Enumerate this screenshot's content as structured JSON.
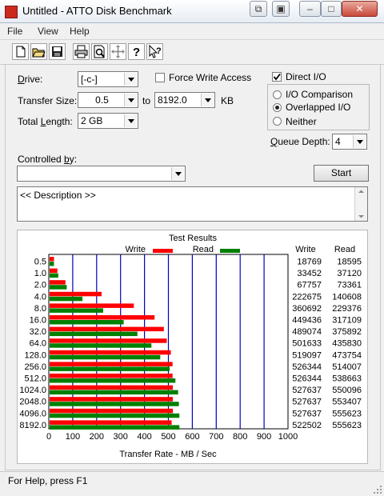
{
  "window": {
    "title": "Untitled - ATTO Disk Benchmark"
  },
  "menu": [
    "File",
    "View",
    "Help"
  ],
  "toolbar_icons": [
    "new-file-icon",
    "open-folder-icon",
    "save-icon",
    "print-icon",
    "print-preview-icon",
    "move-icon",
    "help-icon",
    "context-help-icon"
  ],
  "form": {
    "drive_label": "Drive:",
    "drive_value": "[-c-]",
    "force_write_label": "Force Write Access",
    "force_write_checked": false,
    "direct_io_label": "Direct I/O",
    "direct_io_checked": true,
    "transfer_size_label": "Transfer Size:",
    "transfer_from": "0.5",
    "to_label": "to",
    "transfer_to": "8192.0",
    "kb_label": "KB",
    "total_length_label": "Total Length:",
    "total_length_value": "2 GB",
    "io_options": [
      {
        "label": "I/O Comparison",
        "selected": false
      },
      {
        "label": "Overlapped I/O",
        "selected": true
      },
      {
        "label": "Neither",
        "selected": false
      }
    ],
    "queue_depth_label": "Queue Depth:",
    "queue_depth_value": "4",
    "controlled_by_label": "Controlled by:",
    "controlled_by_value": "",
    "start_label": "Start",
    "description": "<< Description >>"
  },
  "results": {
    "title": "Test Results",
    "legend_write": "Write",
    "legend_read": "Read",
    "col_write": "Write",
    "col_read": "Read",
    "write_color": "#ff0000",
    "read_color": "#008000",
    "grid_color": "#0000c0"
  },
  "chart_data": {
    "type": "bar",
    "orientation": "horizontal",
    "categories": [
      "0.5",
      "1.0",
      "2.0",
      "4.0",
      "8.0",
      "16.0",
      "32.0",
      "64.0",
      "128.0",
      "256.0",
      "512.0",
      "1024.0",
      "2048.0",
      "4096.0",
      "8192.0"
    ],
    "series": [
      {
        "name": "Write",
        "values": [
          18769,
          33452,
          67757,
          222675,
          360692,
          449436,
          489074,
          501633,
          519097,
          526344,
          526344,
          527637,
          527637,
          527637,
          522502
        ]
      },
      {
        "name": "Read",
        "values": [
          18595,
          37120,
          73361,
          140608,
          229376,
          317109,
          375892,
          435830,
          473754,
          514007,
          538663,
          550096,
          553407,
          555623,
          555623
        ]
      }
    ],
    "xlabel": "Transfer Rate - MB / Sec",
    "xlim": [
      0,
      1000
    ],
    "xticks": [
      "0",
      "100",
      "200",
      "300",
      "400",
      "500",
      "600",
      "700",
      "800",
      "900",
      "1000"
    ]
  },
  "status": {
    "text": "For Help, press F1"
  }
}
